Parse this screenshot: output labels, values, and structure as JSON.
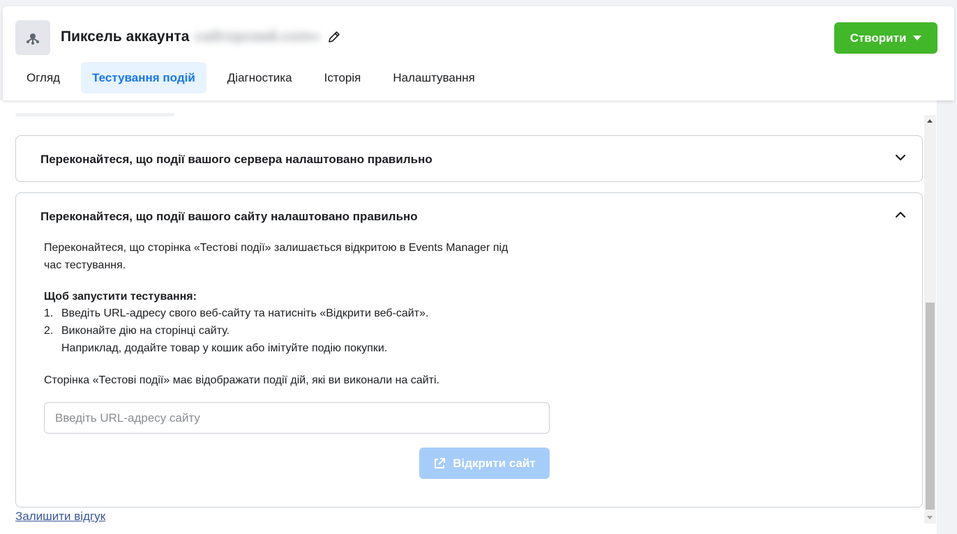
{
  "header": {
    "title": "Пиксель аккаунта",
    "domain_blurred": "сабгорский.com»",
    "create_button": "Створити",
    "icons": {
      "pixel": "pixel-icon",
      "edit": "pencil-icon",
      "caret": "caret-down-icon"
    }
  },
  "tabs": [
    {
      "label": "Огляд",
      "active": false
    },
    {
      "label": "Тестування подій",
      "active": true
    },
    {
      "label": "Діагностика",
      "active": false
    },
    {
      "label": "Історія",
      "active": false
    },
    {
      "label": "Налаштування",
      "active": false
    }
  ],
  "server_section": {
    "title": "Переконайтеся, що події вашого сервера налаштовано правильно",
    "expanded": false
  },
  "site_section": {
    "title": "Переконайтеся, що події вашого сайту налаштовано правильно",
    "expanded": true,
    "intro_line1": "Переконайтеся, що сторінка «Тестові події» залишається відкритою в Events Manager під",
    "intro_line2": "час тестування.",
    "steps_heading": "Щоб запустити тестування:",
    "step1_num": "1.",
    "step1": "Введіть URL-адресу свого веб-сайту та натисніть «Відкрити веб-сайт».",
    "step2_num": "2.",
    "step2": "Виконайте дію на сторінці сайту.",
    "step2_sub": "Наприклад, додайте товар у кошик або імітуйте подію покупки.",
    "outro": "Сторінка «Тестові події» має відображати події дій, які ви виконали на сайті.",
    "url_placeholder": "Введіть URL-адресу сайту",
    "url_value": "",
    "open_site_button": "Відкрити сайт"
  },
  "feedback_link": "Залишити відгук",
  "colors": {
    "accent": "#1877f2",
    "create_green": "#42b72a",
    "disabled_button": "#a6cdfa",
    "tab_active_bg": "#e7f3ff",
    "link": "#385898"
  }
}
